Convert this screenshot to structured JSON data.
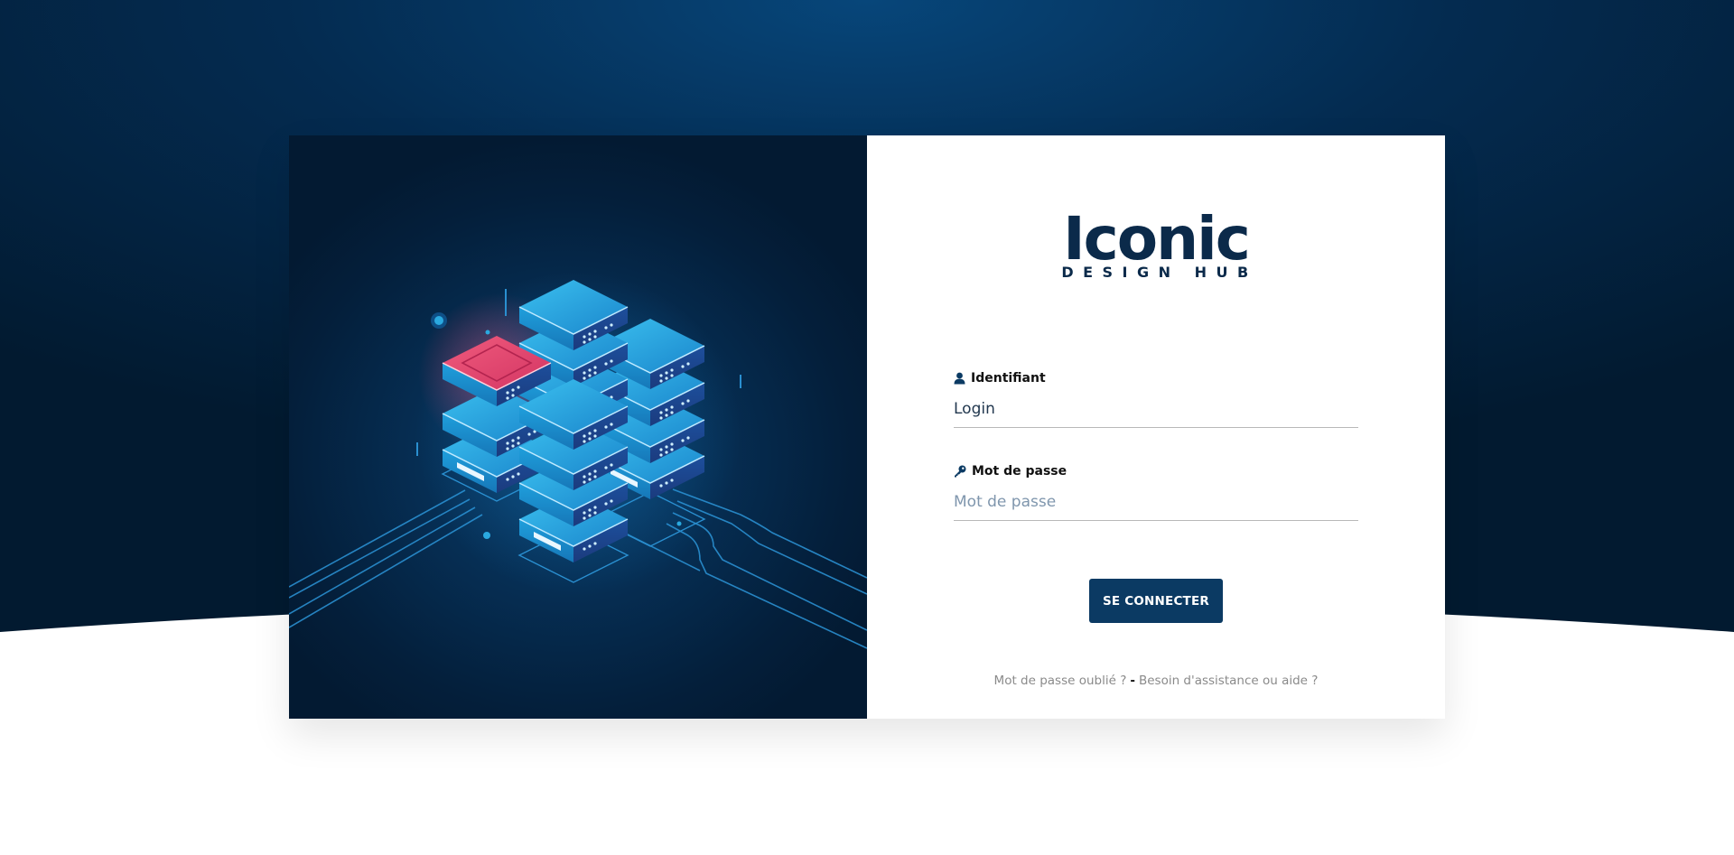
{
  "logo": {
    "main": "Iconic",
    "sub": "DESIGN HUB"
  },
  "form": {
    "username": {
      "label": "Identifiant",
      "value": "Login",
      "icon": "user-icon"
    },
    "password": {
      "label": "Mot de passe",
      "placeholder": "Mot de passe",
      "icon": "key-icon"
    },
    "submit_label": "SE CONNECTER"
  },
  "links": {
    "forgot": "Mot de passe oublié ?",
    "separator": "-",
    "help": "Besoin d'assistance ou aide ?"
  },
  "colors": {
    "navy": "#0b2a4a",
    "button": "#0b3a63",
    "background_dark": "#031a32",
    "server_blue": "#2aa9e0",
    "server_red": "#e8436b"
  }
}
